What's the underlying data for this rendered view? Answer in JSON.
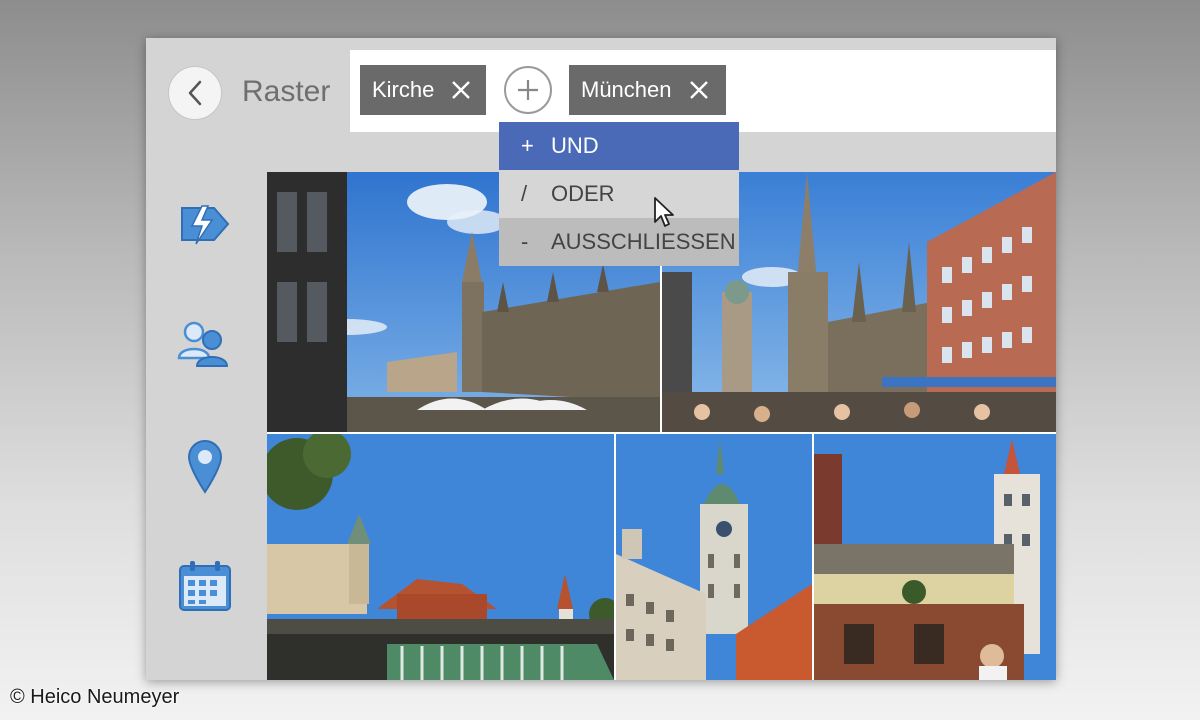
{
  "header": {
    "title": "Raster"
  },
  "filters": {
    "chips": [
      {
        "label": "Kirche"
      },
      {
        "label": "München"
      }
    ]
  },
  "dropdown": {
    "items": [
      {
        "symbol": "+",
        "label": "UND",
        "selected": true
      },
      {
        "symbol": "/",
        "label": "ODER",
        "selected": false
      },
      {
        "symbol": "-",
        "label": "AUSSCHLIESSEN",
        "selected": false
      }
    ]
  },
  "sidebar": {
    "icons": [
      "lightning-tag-icon",
      "people-icon",
      "location-pin-icon",
      "calendar-icon"
    ]
  },
  "photos": [
    {
      "name": "marienplatz-rathaus-left-photo"
    },
    {
      "name": "marienplatz-rathaus-right-photo"
    },
    {
      "name": "viktualienmarkt-photo"
    },
    {
      "name": "alter-peter-tower-photo"
    },
    {
      "name": "altes-rathaus-photo"
    }
  ],
  "colors": {
    "accent": "#4a6ab8",
    "chip": "#6a6a6a",
    "sky": "#3f86d9",
    "icon": "#4a8fd6"
  },
  "credit": "© Heico Neumeyer"
}
